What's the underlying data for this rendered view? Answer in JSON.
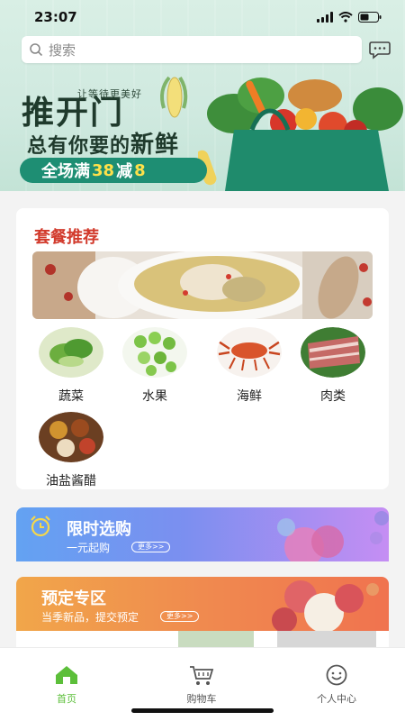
{
  "status_bar": {
    "time": "23:07"
  },
  "search": {
    "placeholder": "搜索"
  },
  "hero": {
    "slogan_small": "让等待更美好",
    "slogan_big": "推开门",
    "slogan_mid_1": "总有你要的",
    "slogan_mid_2": "新鲜",
    "promo_prefix": "全场满",
    "promo_num1": "38",
    "promo_mid": "减",
    "promo_num2": "8"
  },
  "combo": {
    "title": "套餐推荐",
    "categories": [
      {
        "label": "蔬菜",
        "icon": "vegetable-image"
      },
      {
        "label": "水果",
        "icon": "fruit-image"
      },
      {
        "label": "海鲜",
        "icon": "seafood-image"
      },
      {
        "label": "肉类",
        "icon": "meat-image"
      },
      {
        "label": "油盐酱醋",
        "icon": "condiment-image"
      }
    ]
  },
  "flash_sale": {
    "title": "限时选购",
    "subtitle": "一元起购",
    "more": "更多>>"
  },
  "preorder": {
    "title": "预定专区",
    "subtitle": "当季新品，提交预定",
    "more": "更多>>"
  },
  "tabbar": {
    "tabs": [
      {
        "label": "首页",
        "icon": "home-icon",
        "active": true
      },
      {
        "label": "购物车",
        "icon": "cart-icon",
        "active": false
      },
      {
        "label": "个人中心",
        "icon": "smiley-icon",
        "active": false
      }
    ]
  },
  "colors": {
    "accent_green": "#5cbf3a",
    "title_red": "#d23a2c"
  }
}
